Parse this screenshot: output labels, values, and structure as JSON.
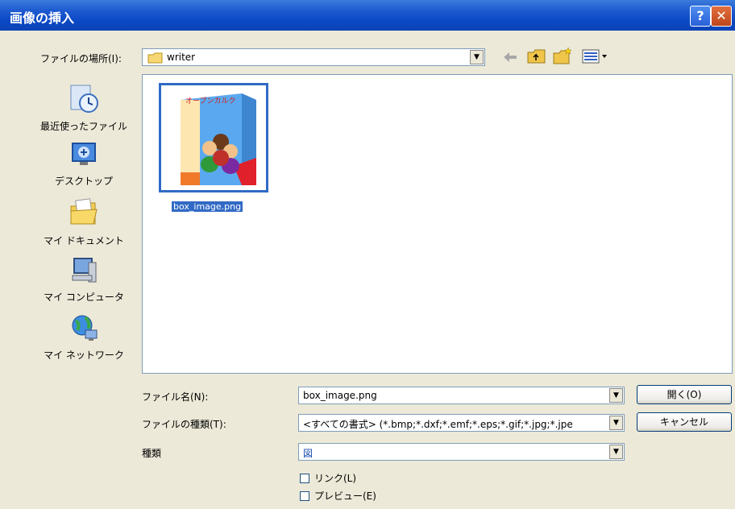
{
  "dialog": {
    "title": "画像の挿入",
    "help_label": "?",
    "close_label": "✕"
  },
  "location": {
    "label": "ファイルの場所(I):",
    "folder": "writer"
  },
  "places": [
    {
      "label": "最近使ったファイル",
      "icon": "recent-documents-icon"
    },
    {
      "label": "デスクトップ",
      "icon": "desktop-icon"
    },
    {
      "label": "マイ ドキュメント",
      "icon": "my-documents-icon"
    },
    {
      "label": "マイ コンピュータ",
      "icon": "my-computer-icon"
    },
    {
      "label": "マイ ネットワーク",
      "icon": "my-network-icon"
    }
  ],
  "files": [
    {
      "name": "box_image.png",
      "thumbnail_text": "オープンカルク",
      "selected": true
    }
  ],
  "form": {
    "filename_label": "ファイル名(N):",
    "filename_value": "box_image.png",
    "filetype_label": "ファイルの種類(T):",
    "filetype_value": "<すべての書式> (*.bmp;*.dxf;*.emf;*.eps;*.gif;*.jpg;*.jpe",
    "style_label": "種類",
    "style_value": "図",
    "link_label": "リンク(L)",
    "preview_label": "プレビュー(E)",
    "open_button": "開く(O)",
    "cancel_button": "キャンセル"
  },
  "colors": {
    "title_bar": "#0a48c4",
    "selection": "#316ac5",
    "dialog_bg": "#ece9d8"
  }
}
